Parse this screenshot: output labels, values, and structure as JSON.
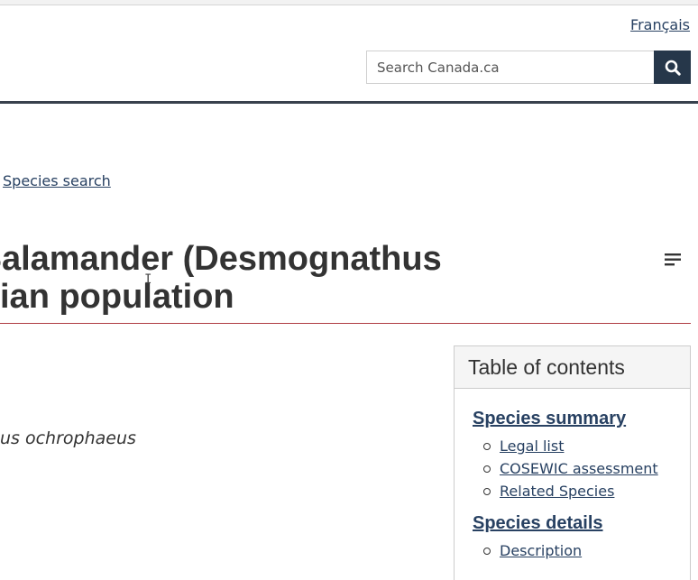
{
  "header": {
    "language_link": "Français",
    "search": {
      "placeholder": "Search Canada.ca",
      "button_icon": "search-icon"
    }
  },
  "breadcrumb": {
    "link": "Species search"
  },
  "page": {
    "title_line1": "Dusky Salamander (Desmognathus",
    "title_line2": "ian population",
    "scientific_name": "us ochrophaeus",
    "menu_icon": "hamburger-menu-icon"
  },
  "toc": {
    "title": "Table of contents",
    "sections": [
      {
        "label": "Species summary",
        "items": [
          "Legal list",
          "COSEWIC assessment",
          "Related Species"
        ]
      },
      {
        "label": "Species details",
        "items": [
          "Description"
        ]
      }
    ]
  },
  "colors": {
    "link": "#284162",
    "search_button": "#26374a",
    "title_rule": "#af3c43",
    "header_rule": "#38414d"
  }
}
